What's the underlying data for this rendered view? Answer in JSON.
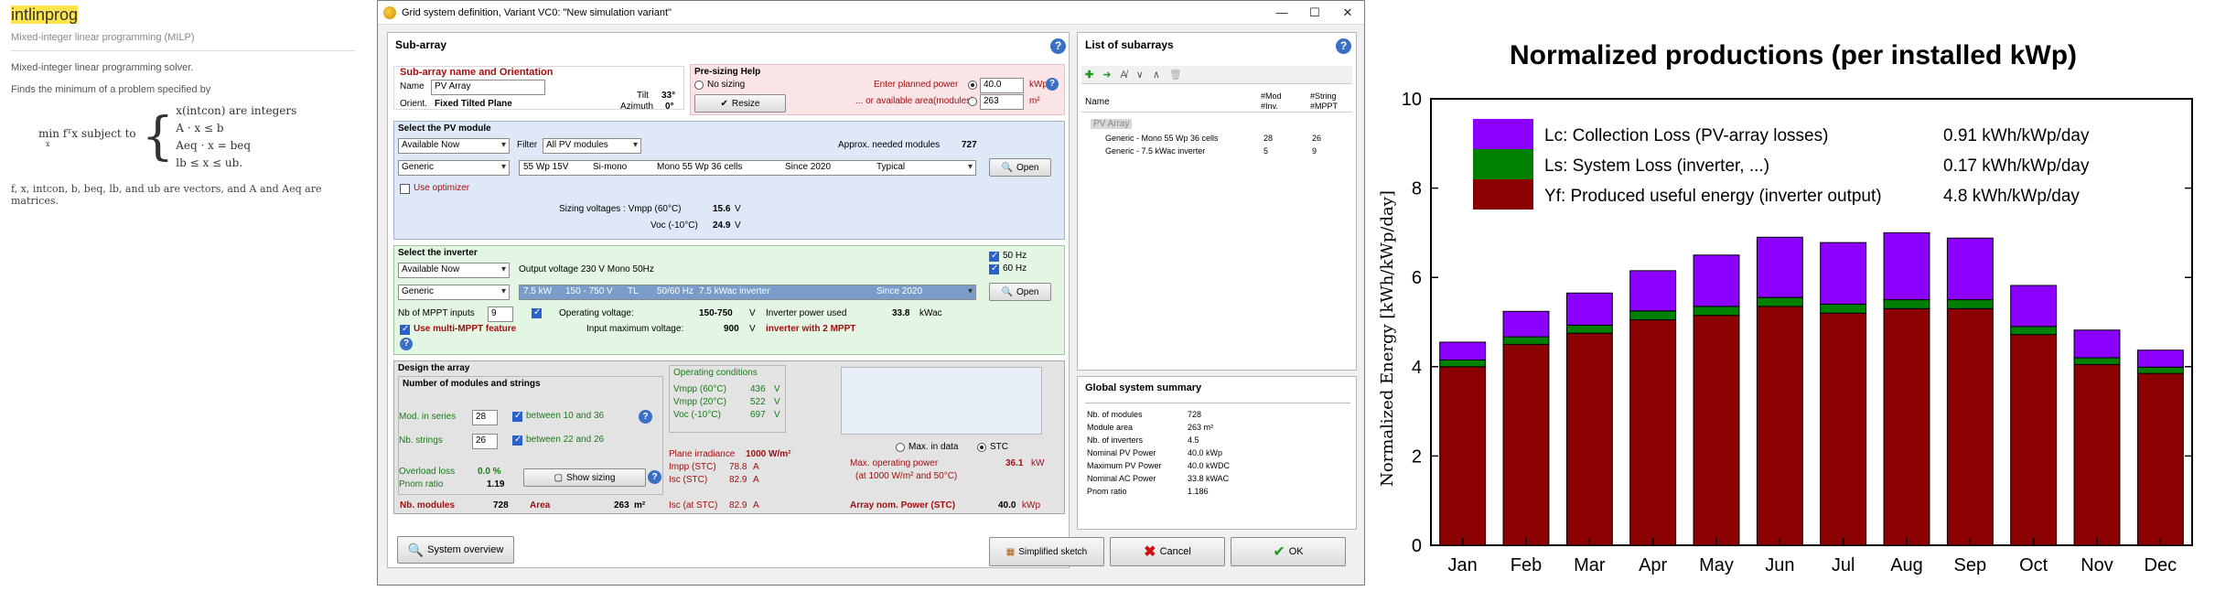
{
  "doc": {
    "title": "intlinprog",
    "subtitle": "Mixed-integer linear programming (MILP)",
    "line1": "Mixed-integer linear programming solver.",
    "line2": "Finds the minimum of a problem specified by",
    "min_expr": "min fᵀx subject to",
    "min_sub": "x",
    "constraints": [
      "x(intcon) are integers",
      "A · x ≤ b",
      "Aeq · x = beq",
      "lb ≤ x ≤ ub."
    ],
    "footer": "f, x, intcon, b, beq, lb, and ub are vectors, and A and Aeq are matrices."
  },
  "window": {
    "title": "Grid system definition, Variant VC0:   \"New simulation variant\"",
    "subarray": {
      "panel_title": "Sub-array",
      "name_orient_title": "Sub-array name and Orientation",
      "name_label": "Name",
      "name_value": "PV Array",
      "orient_label": "Orient.",
      "orient_value": "Fixed Tilted Plane",
      "tilt_label": "Tilt",
      "tilt_value": "33°",
      "azimuth_label": "Azimuth",
      "azimuth_value": "0°",
      "presizing_title": "Pre-sizing Help",
      "no_sizing": "No sizing",
      "enter_power_label": "Enter planned power",
      "enter_power_value": "40.0",
      "enter_power_unit": "kWp",
      "area_label": "... or available area(modules)",
      "area_value": "263",
      "area_unit": "m²",
      "resize_button": "Resize"
    },
    "pv_module": {
      "title": "Select the PV module",
      "availability": "Available Now",
      "filter_label": "Filter",
      "filter_value": "All PV modules",
      "approx_label": "Approx. needed modules",
      "approx_value": "727",
      "manufacturer": "Generic",
      "model_cols": [
        "55 Wp 15V",
        "Si-mono",
        "Mono 55 Wp 36 cells",
        "Since 2020",
        "Typical"
      ],
      "open_button": "Open",
      "use_optimizer": "Use optimizer",
      "sizing_voltages_label": "Sizing voltages :  Vmpp (60°C)",
      "vmpp_value": "15.6",
      "volt_unit": "V",
      "voc_label": "Voc (-10°C)",
      "voc_value": "24.9"
    },
    "inverter": {
      "title": "Select the inverter",
      "availability": "Available Now",
      "output_voltage": "Output voltage 230 V Mono 50Hz",
      "hz50": "50 Hz",
      "hz60": "60 Hz",
      "manufacturer": "Generic",
      "model_cols": [
        "7.5 kW",
        "150 - 750 V",
        "TL",
        "50/60 Hz",
        "7.5 kWac inverter",
        "Since 2020"
      ],
      "open_button": "Open",
      "mppt_label": "Nb of MPPT inputs",
      "mppt_value": "9",
      "op_voltage_label": "Operating voltage:",
      "op_voltage_value": "150-750",
      "op_voltage_unit": "V",
      "power_used_label": "Inverter power used",
      "power_used_value": "33.8",
      "power_used_unit": "kWac",
      "multi_mppt": "Use multi-MPPT feature",
      "input_max_label": "Input maximum voltage:",
      "input_max_value": "900",
      "input_max_unit": "V",
      "inverter_with": "inverter with 2 MPPT"
    },
    "design": {
      "title": "Design the array",
      "nb_title": "Number of modules and strings",
      "mod_series_label": "Mod. in series",
      "mod_series_value": "28",
      "mod_series_range": "between 10 and 36",
      "nb_strings_label": "Nb. strings",
      "nb_strings_value": "26",
      "nb_strings_range": "between 22 and 26",
      "overload_label": "Overload loss",
      "overload_value": "0.0 %",
      "pnom_label": "Pnom ratio",
      "pnom_value": "1.19",
      "show_sizing": "Show sizing",
      "nb_modules_label": "Nb. modules",
      "nb_modules_value": "728",
      "area_label": "Area",
      "area_value": "263",
      "area_unit": "m²",
      "op_cond_title": "Operating conditions",
      "vmpp60_label": "Vmpp (60°C)",
      "vmpp60_value": "436",
      "vmpp20_label": "Vmpp (20°C)",
      "vmpp20_value": "522",
      "voc10_label": "Voc (-10°C)",
      "voc10_value": "697",
      "unit_v": "V",
      "max_in_data": "Max. in data",
      "stc": "STC",
      "plane_irr_label": "Plane irradiance",
      "plane_irr_value": "1000 W/m²",
      "impp_label": "Impp (STC)",
      "impp_value": "78.8",
      "isc_label": "Isc (STC)",
      "isc_value": "82.9",
      "unit_a": "A",
      "max_op_power_label": "Max. operating power",
      "max_op_power_value": "36.1",
      "max_op_power_unit": "kW",
      "max_op_power_note": "(at 1000 W/m² and 50°C)",
      "isc_at_stc_label": "Isc (at STC)",
      "isc_at_stc_value": "82.9",
      "array_nom_label": "Array nom. Power (STC)",
      "array_nom_value": "40.0",
      "array_nom_unit": "kWp"
    },
    "subarrays_list": {
      "title": "List of subarrays",
      "col_name": "Name",
      "col_mod": "#Mod\n#Inv.",
      "col_string": "#String\n#MPPT",
      "group": "PV Array",
      "rows": [
        {
          "name": "Generic - Mono 55 Wp 36 cells",
          "a": "28",
          "b": "26"
        },
        {
          "name": "Generic - 7.5 kWac inverter",
          "a": "5",
          "b": "9"
        }
      ]
    },
    "summary": {
      "title": "Global system summary",
      "rows": [
        {
          "label": "Nb. of modules",
          "value": "728"
        },
        {
          "label": "Module area",
          "value": "263 m²"
        },
        {
          "label": "Nb. of inverters",
          "value": "4.5"
        },
        {
          "label": "Nominal PV Power",
          "value": "40.0  kWp"
        },
        {
          "label": "Maximum PV Power",
          "value": "40.0  kWDC"
        },
        {
          "label": "Nominal AC Power",
          "value": "33.8  kWAC"
        },
        {
          "label": "Pnom ratio",
          "value": "1.186"
        }
      ]
    },
    "buttons": {
      "overview": "System overview",
      "sketch": "Simplified sketch",
      "cancel": "Cancel",
      "ok": "OK"
    }
  },
  "colors": {
    "pv_bg": "#dfe8f7",
    "inv_bg": "#e3f5e3",
    "design_bg": "#e3e3e3",
    "presize_bg": "#fbe4e6",
    "lc": "#8b00ff",
    "ls": "#008000",
    "yf": "#8b0000"
  },
  "chart_data": {
    "type": "bar",
    "stacked": true,
    "title": "Normalized productions (per installed kWp)",
    "xlabel": "",
    "ylabel": "Normalized Energy [kWh/kWp/day]",
    "ylim": [
      0,
      10
    ],
    "yticks": [
      0,
      2,
      4,
      6,
      8,
      10
    ],
    "grid": false,
    "legend_position": "top-left",
    "categories": [
      "Jan",
      "Feb",
      "Mar",
      "Apr",
      "May",
      "Jun",
      "Jul",
      "Aug",
      "Sep",
      "Oct",
      "Nov",
      "Dec"
    ],
    "series": [
      {
        "name": "Yf: Produced useful energy  (inverter output)",
        "legend_value": "4.8 kWh/kWp/day",
        "color": "#8b0000",
        "values": [
          4.0,
          4.5,
          4.75,
          5.05,
          5.15,
          5.35,
          5.2,
          5.3,
          5.3,
          4.72,
          4.05,
          3.85
        ]
      },
      {
        "name": "Ls: System Loss  (inverter, ...)",
        "legend_value": "0.17 kWh/kWp/day",
        "color": "#008000",
        "values": [
          0.15,
          0.17,
          0.18,
          0.2,
          0.2,
          0.2,
          0.2,
          0.2,
          0.2,
          0.18,
          0.15,
          0.14
        ]
      },
      {
        "name": "Lc: Collection Loss (PV-array losses)",
        "legend_value": "0.91 kWh/kWp/day",
        "color": "#8b00ff",
        "values": [
          0.4,
          0.57,
          0.72,
          0.9,
          1.15,
          1.35,
          1.38,
          1.5,
          1.38,
          0.92,
          0.62,
          0.38
        ]
      }
    ]
  }
}
